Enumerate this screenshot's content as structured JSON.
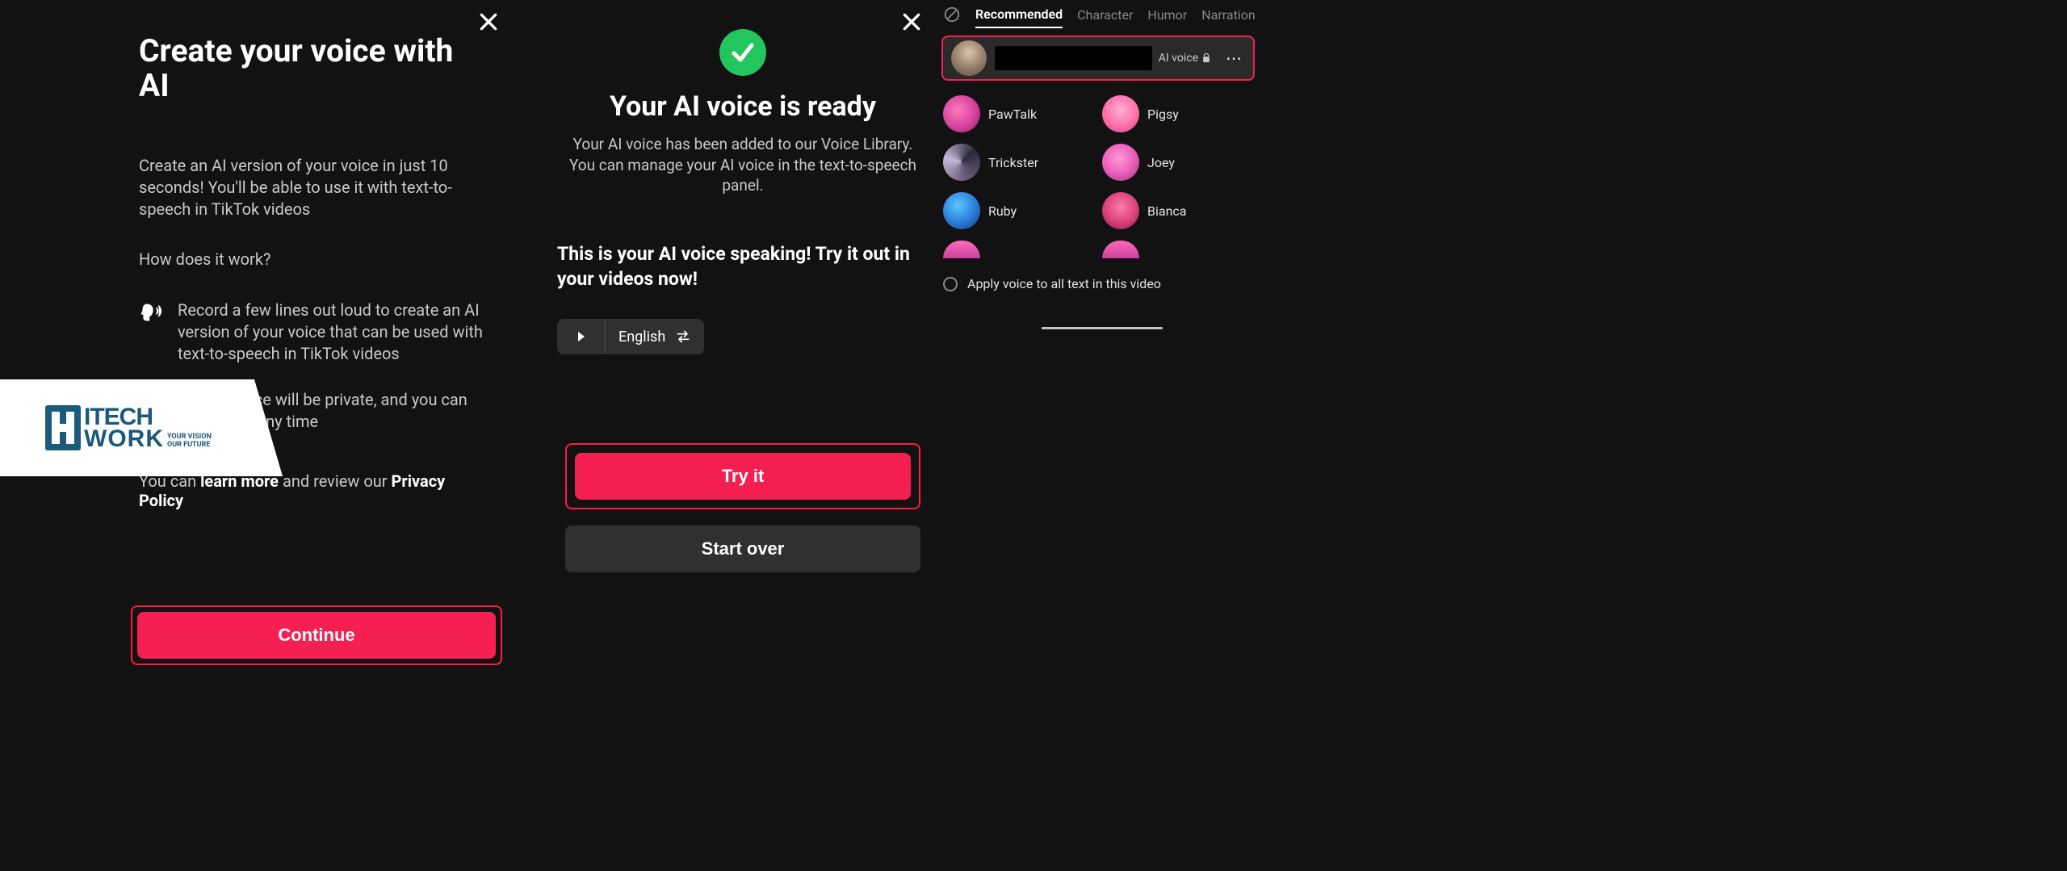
{
  "panelA": {
    "title": "Create your voice with AI",
    "description": "Create an AI version of your voice in just 10 seconds! You'll be able to use it with text-to-speech in TikTok videos",
    "how_label": "How does it work?",
    "feature1": "Record a few lines out loud to create an AI version of your voice that can be used with text-to-speech in TikTok videos",
    "feature2": "Your AI voice will be private, and you can delete it at any time",
    "privacy_prefix": "You can ",
    "privacy_learn": "learn more",
    "privacy_mid": " and review our ",
    "privacy_policy": "Privacy Policy",
    "continue_label": "Continue"
  },
  "panelB": {
    "title": "Your AI voice is ready",
    "subtitle": "Your AI voice has been added to our Voice Library. You can manage your AI voice in the text-to-speech panel.",
    "demo_text": "This is your AI voice speaking! Try it out in your videos now!",
    "language_label": "English",
    "try_label": "Try it",
    "startover_label": "Start over"
  },
  "panelC": {
    "tabs": [
      "Recommended",
      "Character",
      "Humor",
      "Narration"
    ],
    "active_tab_index": 0,
    "ai_voice_label": "AI voice",
    "voices": [
      {
        "label": "PawTalk"
      },
      {
        "label": "Pigsy"
      },
      {
        "label": "Trickster"
      },
      {
        "label": "Joey"
      },
      {
        "label": "Ruby"
      },
      {
        "label": "Bianca"
      }
    ],
    "apply_label": "Apply voice to all text in this video"
  },
  "watermark": {
    "line1": "ITECH",
    "line2": "WORK",
    "tag1": "YOUR VISION",
    "tag2": "OUR FUTURE"
  }
}
